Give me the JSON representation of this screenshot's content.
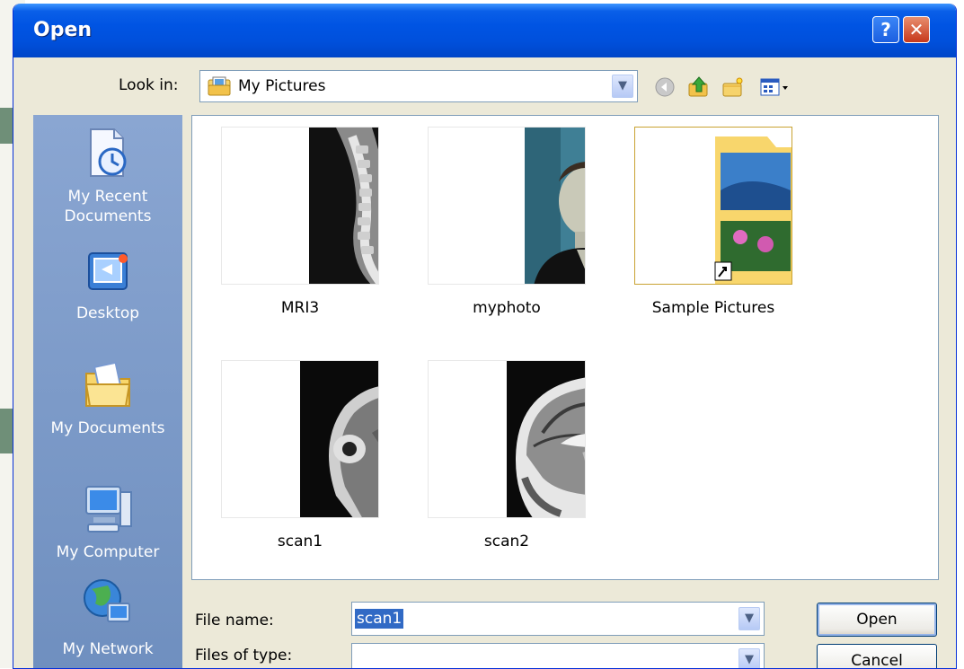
{
  "dialog": {
    "title": "Open",
    "help_glyph": "?",
    "close_glyph": "✕"
  },
  "look_in": {
    "label": "Look in:",
    "value": "My Pictures",
    "icon": "folder-pictures-icon"
  },
  "toolbar": {
    "icons": [
      "back-icon",
      "up-folder-icon",
      "new-folder-icon",
      "views-menu-icon"
    ]
  },
  "places": [
    {
      "label": "My Recent Documents",
      "line1": "My Recent",
      "line2": "Documents",
      "icon": "recent-documents-icon"
    },
    {
      "label": "Desktop",
      "line1": "Desktop",
      "line2": "",
      "icon": "desktop-icon"
    },
    {
      "label": "My Documents",
      "line1": "My Documents",
      "line2": "",
      "icon": "my-documents-icon"
    },
    {
      "label": "My Computer",
      "line1": "My Computer",
      "line2": "",
      "icon": "my-computer-icon"
    },
    {
      "label": "My Network",
      "line1": "My Network",
      "line2": "",
      "icon": "my-network-icon"
    }
  ],
  "files": [
    {
      "name": "MRI3",
      "kind": "spine-mri-image"
    },
    {
      "name": "myphoto",
      "kind": "portrait-photo"
    },
    {
      "name": "Sample Pictures",
      "kind": "folder-shortcut"
    },
    {
      "name": "scan1",
      "kind": "head-mri-image"
    },
    {
      "name": "scan2",
      "kind": "brain-mri-image"
    }
  ],
  "bottom": {
    "file_name_label": "File name:",
    "file_name_value": "scan1",
    "files_of_type_label": "Files of type:",
    "files_of_type_value": "",
    "open_label": "Open",
    "cancel_label": "Cancel"
  },
  "colors": {
    "titlebar": "#0054e3",
    "places_bar": "#7f9cc7",
    "selection": "#316ac5"
  }
}
